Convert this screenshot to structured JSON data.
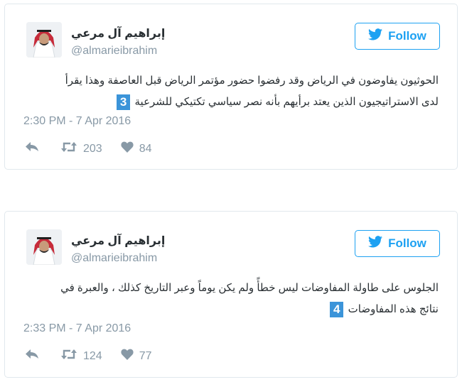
{
  "tweets": [
    {
      "name": "إبراهيم آل مرعي",
      "handle": "@almarieibrahim",
      "follow_label": "Follow",
      "text_line1": "الحوثيون يفاوضون في الرياض وقد رفضوا حضور مؤتمر الرياض قبل العاصفة وهذا يقرأ",
      "text_line2": "لدى الاستراتيجيون الذين يعتد برأيهم بأنه نصر سياسي تكتيكي للشرعية",
      "badge": "3",
      "timestamp": "2:30 PM - 7 Apr 2016",
      "retweets": "203",
      "likes": "84"
    },
    {
      "name": "إبراهيم آل مرعي",
      "handle": "@almarieibrahim",
      "follow_label": "Follow",
      "text_line1": "الجلوس على طاولة المفاوضات ليس خطأً ولم يكن يوماً وعبر التاريخ كذلك ، والعبرة في",
      "text_line2": "نتائج هذه المفاوضات",
      "badge": "4",
      "timestamp": "2:33 PM - 7 Apr 2016",
      "retweets": "124",
      "likes": "77"
    }
  ],
  "colors": {
    "accent": "#1da1f2",
    "badge": "#3b94d9",
    "muted": "#8899a6",
    "text": "#292f33",
    "border": "#e1e8ed"
  },
  "icons": [
    "twitter-bird-icon",
    "reply-icon",
    "retweet-icon",
    "heart-icon",
    "avatar"
  ]
}
